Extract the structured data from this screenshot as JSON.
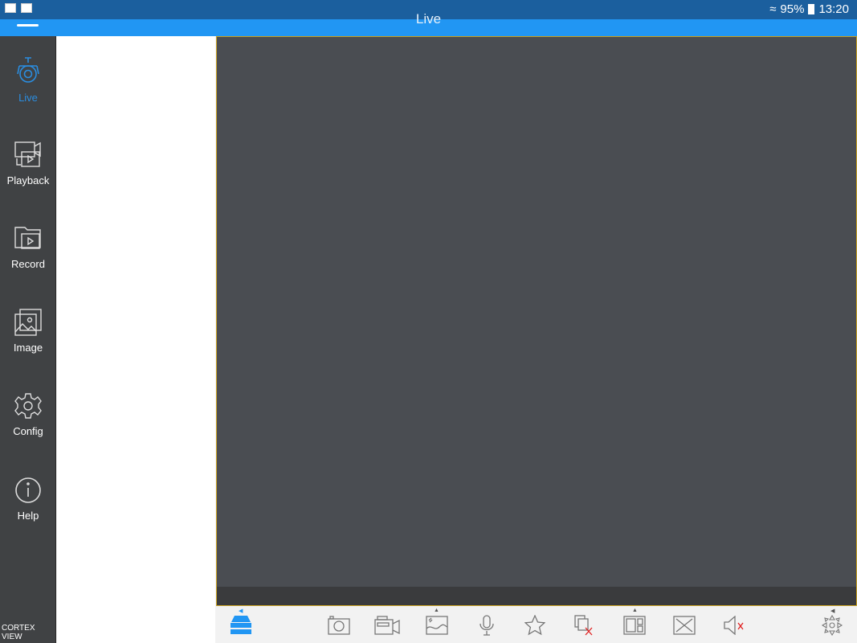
{
  "status_bar": {
    "battery": "95%",
    "time": "13:20",
    "icons": [
      "wifi-icon",
      "battery-charging-icon"
    ]
  },
  "header": {
    "title": "Live"
  },
  "sidebar": {
    "items": [
      {
        "label": "Live",
        "icon": "camera-icon",
        "active": true
      },
      {
        "label": "Playback",
        "icon": "playback-icon"
      },
      {
        "label": "Record",
        "icon": "record-folder-icon"
      },
      {
        "label": "Image",
        "icon": "image-icon"
      },
      {
        "label": "Config",
        "icon": "gear-icon"
      },
      {
        "label": "Help",
        "icon": "info-icon"
      }
    ],
    "brand": "CORTEX VIEW"
  },
  "toolbar": {
    "items": [
      "device-list-icon",
      "snapshot-icon",
      "record-video-icon",
      "quality-icon",
      "microphone-icon",
      "favorite-star-icon",
      "close-all-icon",
      "split-layout-icon",
      "fullscreen-icon",
      "mute-icon",
      "ptz-icon"
    ]
  },
  "colors": {
    "accent": "#2196f3",
    "active": "#2a8de0",
    "video_border": "#c8a020"
  }
}
